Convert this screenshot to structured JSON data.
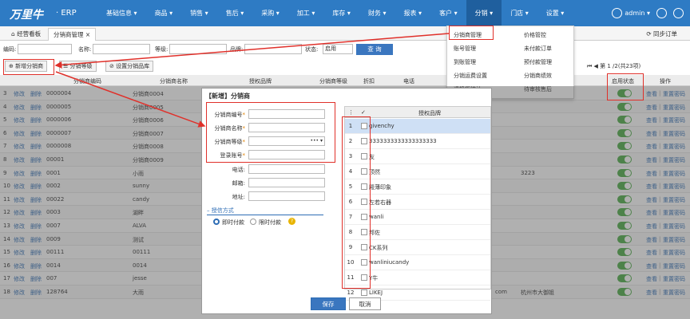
{
  "app": {
    "logo": "万里牛",
    "logo_suffix": "· ERP"
  },
  "nav": {
    "items": [
      "基础信息 ▾",
      "商品 ▾",
      "销售 ▾",
      "售后 ▾",
      "采购 ▾",
      "加工 ▾",
      "库存 ▾",
      "财务 ▾",
      "报表 ▾",
      "客户 ▾",
      "分销 ▾",
      "门店 ▾",
      "设置 ▾"
    ],
    "user": "admin ▾"
  },
  "tabs": {
    "home": "⌂ 经营看板",
    "current": "分销商管理 ×",
    "sync": "⟳ 同步订单"
  },
  "filter": {
    "code_label": "编码:",
    "name_label": "名称:",
    "level_label": "等级:",
    "brand_label": "品牌:",
    "status_label": "状态:",
    "status_value": "启用",
    "query": "查 询"
  },
  "toolbar": {
    "add": "⊕ 新增分销商",
    "level": "☰ 分销等级",
    "setbrand": "⊘ 设置分销品库"
  },
  "pager": "⏮ ◀ 第 1 /2(共23项)",
  "table": {
    "headers": [
      "分销商编码",
      "分销商名称",
      "授权品牌",
      "分销商等级",
      "折扣",
      "电话",
      "启用状态",
      "操作"
    ],
    "rows": [
      {
        "n": "3",
        "code": "0000004",
        "name": "分销商0004"
      },
      {
        "n": "4",
        "code": "0000005",
        "name": "分销商0005"
      },
      {
        "n": "5",
        "code": "0000006",
        "name": "分销商0006"
      },
      {
        "n": "6",
        "code": "0000007",
        "name": "分销商0007"
      },
      {
        "n": "7",
        "code": "0000008",
        "name": "分销商0008"
      },
      {
        "n": "8",
        "code": "00001",
        "name": "分销商0009"
      },
      {
        "n": "9",
        "code": "0001",
        "name": "小雨",
        "extra": "3223"
      },
      {
        "n": "10",
        "code": "0002",
        "name": "sunny"
      },
      {
        "n": "11",
        "code": "00022",
        "name": "candy"
      },
      {
        "n": "12",
        "code": "0003",
        "name": "湖畔"
      },
      {
        "n": "13",
        "code": "0007",
        "name": "ALVA"
      },
      {
        "n": "14",
        "code": "0009",
        "name": "测试"
      },
      {
        "n": "15",
        "code": "00111",
        "name": "00111"
      },
      {
        "n": "16",
        "code": "0014",
        "name": "0014"
      },
      {
        "n": "17",
        "code": "007",
        "name": "jesse"
      },
      {
        "n": "18",
        "code": "128764",
        "name": "大雨",
        "extra": "杭州市大御姐",
        "extra2": "com"
      }
    ],
    "edit": "修改",
    "del": "删除",
    "view": "查看",
    "reset": "重置密码"
  },
  "dropdown": {
    "left": [
      "分销商管理",
      "账号管理",
      "到账管理",
      "分销运费设置",
      "退换货统计"
    ],
    "right": [
      "价格管控",
      "未付款订单",
      "预付款管理",
      "分销商绩效",
      "待审核售后"
    ]
  },
  "modal": {
    "title": "【新增】分销商",
    "fields": [
      "分销商编号",
      "分销商名称",
      "分销商等级",
      "登录账号",
      "电话:",
      "邮箱:",
      "地址:"
    ],
    "level_value": "•••  ▾",
    "credit_label": "授信方式",
    "pay_now": "即时付款",
    "pay_later": "限时付款",
    "grid_header": "授权品牌",
    "brands": [
      "givenchy",
      "3333333333333333333",
      "友",
      "顶然",
      "殿薄印象",
      "左若右器",
      "wanli",
      "邦佐",
      "CK系列",
      "wanliniucandy",
      "Y牛",
      "LIKEJ"
    ],
    "save": "保存",
    "cancel": "取消"
  },
  "colors": {
    "nav": "#2e7bc4",
    "accent": "#e0302a",
    "toggle": "#4bab45"
  }
}
